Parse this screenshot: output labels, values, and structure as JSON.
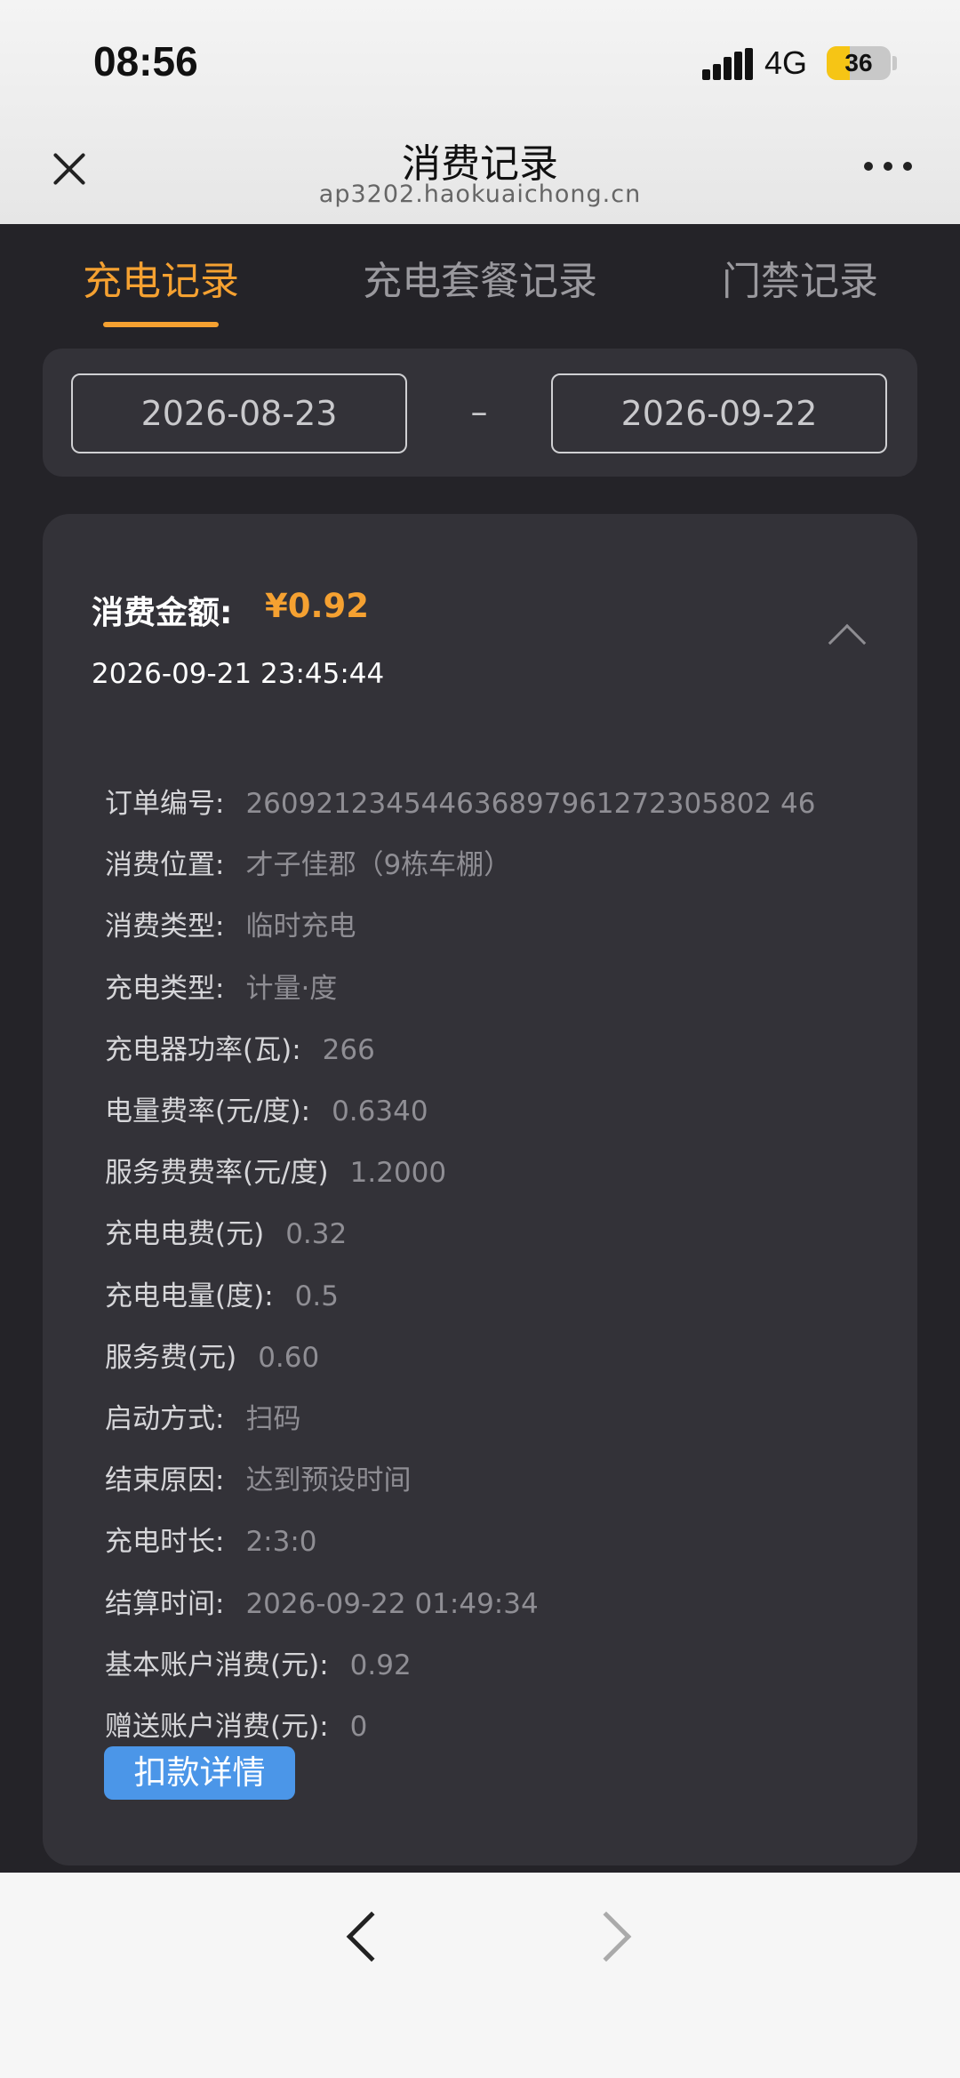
{
  "status": {
    "time": "08:56",
    "network": "4G",
    "battery": "36",
    "battery_level": 0.36
  },
  "browser": {
    "title": "消费记录",
    "url": "ap3202.haokuaichong.cn"
  },
  "tabs": [
    {
      "label": "充电记录",
      "active": true
    },
    {
      "label": "充电套餐记录",
      "active": false
    },
    {
      "label": "门禁记录",
      "active": false
    }
  ],
  "date_filter": {
    "start": "2026-08-23",
    "separator": "–",
    "end": "2026-09-22"
  },
  "record": {
    "amount_label": "消费金额:",
    "amount_value": "¥0.92",
    "time": "2026-09-21 23:45:44",
    "details": [
      {
        "label": "订单编号:",
        "value": "260921234544636897961272305802 46"
      },
      {
        "label": "消费位置:",
        "value": "才子佳郡（9栋车棚）"
      },
      {
        "label": "消费类型:",
        "value": "临时充电"
      },
      {
        "label": "充电类型:",
        "value": "计量·度"
      },
      {
        "label": "充电器功率(瓦):",
        "value": "266"
      },
      {
        "label": "电量费率(元/度):",
        "value": "0.6340"
      },
      {
        "label": "服务费费率(元/度)",
        "value": "1.2000"
      },
      {
        "label": "充电电费(元)",
        "value": "0.32"
      },
      {
        "label": "充电电量(度):",
        "value": "0.5"
      },
      {
        "label": "服务费(元)",
        "value": "0.60"
      },
      {
        "label": "启动方式:",
        "value": "扫码"
      },
      {
        "label": "结束原因:",
        "value": "达到预设时间"
      },
      {
        "label": "充电时长:",
        "value": "2:3:0"
      },
      {
        "label": "结算时间:",
        "value": "2026-09-22 01:49:34"
      },
      {
        "label": "基本账户消费(元):",
        "value": "0.92"
      },
      {
        "label": "赠送账户消费(元):",
        "value": "0"
      }
    ],
    "deduct_button": "扣款详情"
  },
  "colors": {
    "accent": "#f5a131",
    "button_blue": "#4b96e8",
    "background": "#242328",
    "card": "#333238"
  }
}
